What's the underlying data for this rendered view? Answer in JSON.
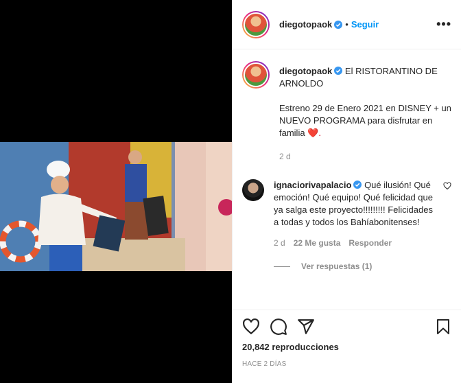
{
  "post": {
    "username": "diegotopaok",
    "follow_label": "Seguir",
    "dot": "•",
    "more": "•••",
    "caption_line1": "El RISTORANTINO DE ARNOLDO",
    "caption_line2": "Estreno 29 de Enero 2021 en DISNEY + un NUEVO PROGRAMA para disfrutar en familia",
    "caption_emoji": "❤️.",
    "caption_time": "2 d"
  },
  "comment": {
    "username": "ignaciorivapalacio",
    "text": "Qué ilusión! Qué emoción! Qué equipo! Qué felicidad que ya salga este proyecto!!!!!!!!! Felicidades a todas y todos los Bahíabonitenses!",
    "time": "2 d",
    "likes": "22 Me gusta",
    "reply": "Responder",
    "view_replies": "Ver respuestas (1)"
  },
  "footer": {
    "views": "20,842 reproducciones",
    "ago": "HACE 2 DÍAS"
  },
  "icons": {
    "like": "heart-icon",
    "comment": "comment-icon",
    "share": "share-icon",
    "save": "bookmark-icon",
    "verified": "verified-icon"
  },
  "colors": {
    "link": "#0095f6",
    "muted": "#8e8e8e",
    "verified": "#3897f0",
    "emoji_heart": "#d0021b"
  }
}
